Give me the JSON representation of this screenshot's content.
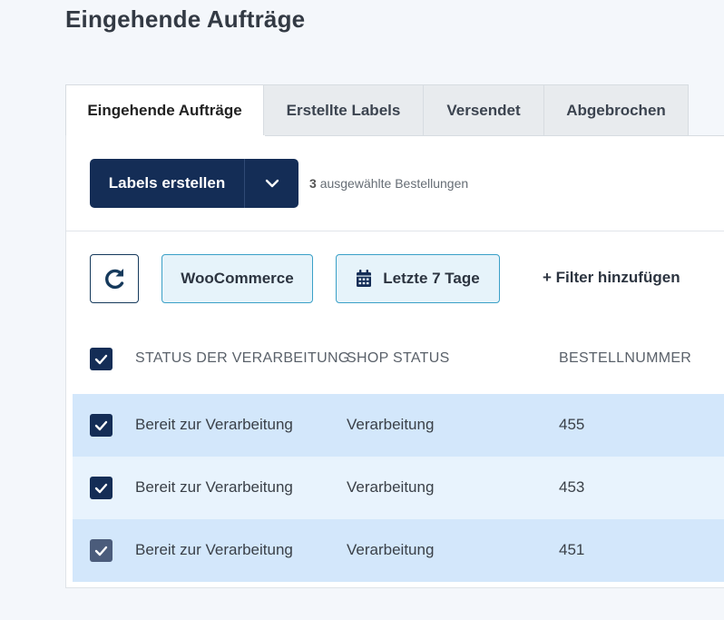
{
  "page": {
    "title": "Eingehende Aufträge"
  },
  "tabs": [
    {
      "label": "Eingehende Aufträge",
      "active": true
    },
    {
      "label": "Erstellte Labels"
    },
    {
      "label": "Versendet"
    },
    {
      "label": "Abgebrochen"
    }
  ],
  "toolbar": {
    "create_labels": "Labels erstellen",
    "dropdown_icon": "chevron-down-icon",
    "selected_count": "3",
    "selected_text": "ausgewählte Bestellungen"
  },
  "filters": {
    "refresh_icon": "refresh-icon",
    "source": "WooCommerce",
    "date_icon": "calendar-icon",
    "date_range": "Letzte 7 Tage",
    "add_filter": "+ Filter hinzufügen"
  },
  "table": {
    "headers": [
      "STATUS DER VERARBEITUNG",
      "SHOP STATUS",
      "BESTELLNUMMER"
    ],
    "rows": [
      {
        "processing_status": "Bereit zur Verarbeitung",
        "shop_status": "Verarbeitung",
        "order_number": "455",
        "checked": true
      },
      {
        "processing_status": "Bereit zur Verarbeitung",
        "shop_status": "Verarbeitung",
        "order_number": "453",
        "checked": true
      },
      {
        "processing_status": "Bereit zur Verarbeitung",
        "shop_status": "Verarbeitung",
        "order_number": "451",
        "checked": true
      }
    ]
  },
  "colors": {
    "primary": "#142d56",
    "chip_border": "#3aa0c7",
    "chip_bg": "#e6f3fa",
    "row_selected": "#d3e7fb",
    "row_selected_alt": "#e8f3fd"
  }
}
